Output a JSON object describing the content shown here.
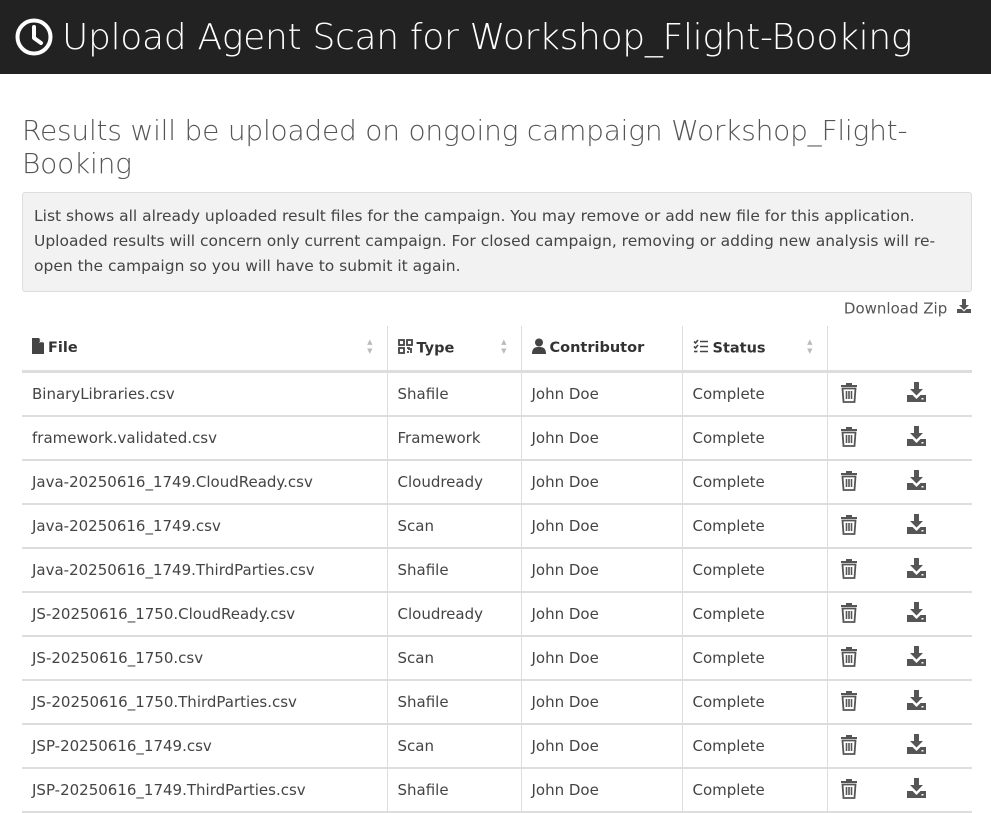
{
  "header": {
    "title": "Upload Agent Scan for Workshop_Flight-Booking",
    "icon": "clock-icon"
  },
  "subtitle": "Results will be uploaded on ongoing campaign Workshop_Flight-Booking",
  "info_text": "List shows all already uploaded result files for the campaign. You may remove or add new file for this application. Uploaded results will concern only current campaign. For closed campaign, removing or adding new analysis will re-open the campaign so you will have to submit it again.",
  "download_zip_label": "Download Zip",
  "table": {
    "columns": [
      {
        "label": "File",
        "icon": "file-icon"
      },
      {
        "label": "Type",
        "icon": "qr-icon"
      },
      {
        "label": "Contributor",
        "icon": "user-icon"
      },
      {
        "label": "Status",
        "icon": "list-check-icon"
      }
    ],
    "rows": [
      {
        "file": "BinaryLibraries.csv",
        "type": "Shafile",
        "contributor": "John Doe",
        "status": "Complete"
      },
      {
        "file": "framework.validated.csv",
        "type": "Framework",
        "contributor": "John Doe",
        "status": "Complete"
      },
      {
        "file": "Java-20250616_1749.CloudReady.csv",
        "type": "Cloudready",
        "contributor": "John Doe",
        "status": "Complete"
      },
      {
        "file": "Java-20250616_1749.csv",
        "type": "Scan",
        "contributor": "John Doe",
        "status": "Complete"
      },
      {
        "file": "Java-20250616_1749.ThirdParties.csv",
        "type": "Shafile",
        "contributor": "John Doe",
        "status": "Complete"
      },
      {
        "file": "JS-20250616_1750.CloudReady.csv",
        "type": "Cloudready",
        "contributor": "John Doe",
        "status": "Complete"
      },
      {
        "file": "JS-20250616_1750.csv",
        "type": "Scan",
        "contributor": "John Doe",
        "status": "Complete"
      },
      {
        "file": "JS-20250616_1750.ThirdParties.csv",
        "type": "Shafile",
        "contributor": "John Doe",
        "status": "Complete"
      },
      {
        "file": "JSP-20250616_1749.csv",
        "type": "Scan",
        "contributor": "John Doe",
        "status": "Complete"
      },
      {
        "file": "JSP-20250616_1749.ThirdParties.csv",
        "type": "Shafile",
        "contributor": "John Doe",
        "status": "Complete"
      }
    ]
  },
  "colors": {
    "header_bg": "#222222",
    "info_bg": "#f2f2f2",
    "border": "#dddddd",
    "icon": "#555555"
  }
}
